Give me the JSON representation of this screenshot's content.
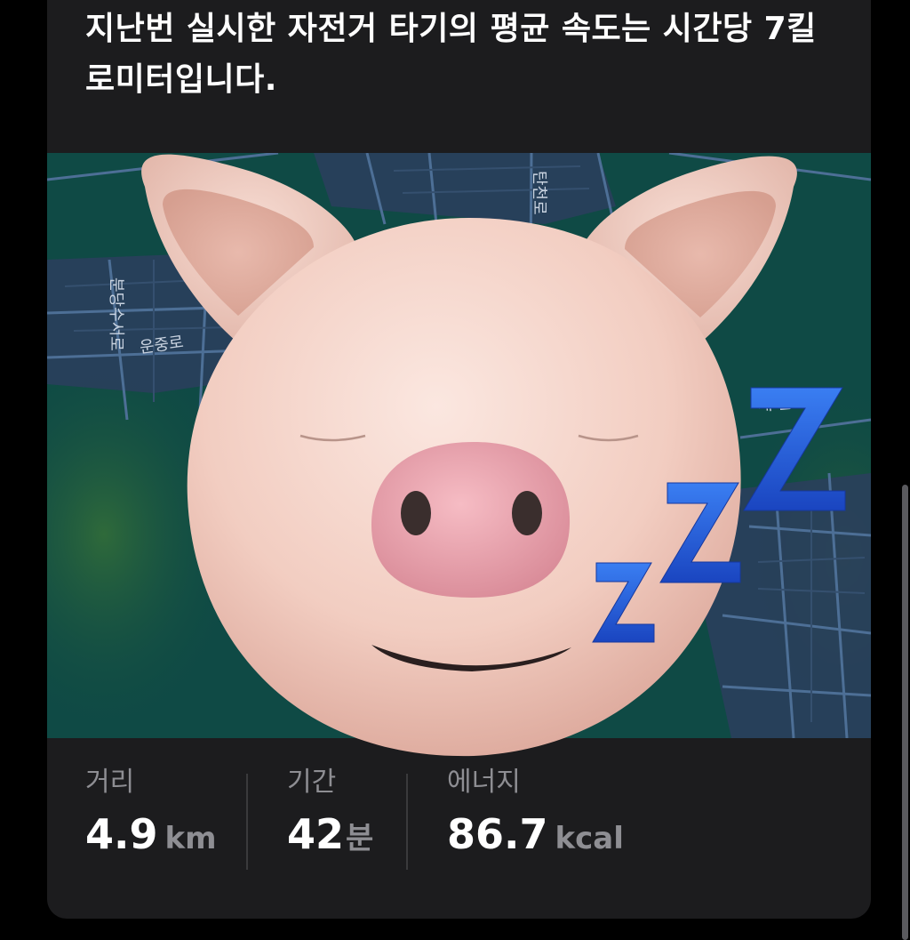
{
  "workout": {
    "headline": "지난번 실시한 자전거 타기의 평균 속도는 시간당 7킬로미터입니다."
  },
  "map": {
    "road_labels": [
      "탄천로",
      "운중로",
      "분당수서로",
      "새 둘로"
    ]
  },
  "emoji": {
    "name": "sleeping-pig-memoji",
    "zzz": [
      "z",
      "Z",
      "Z"
    ]
  },
  "stats": {
    "distance": {
      "label": "거리",
      "value": "4.9",
      "unit": "km"
    },
    "duration": {
      "label": "기간",
      "value": "42",
      "unit": "분"
    },
    "energy": {
      "label": "에너지",
      "value": "86.7",
      "unit": "kcal"
    }
  },
  "colors": {
    "card_bg": "#1c1c1e",
    "map_green": "#0f4a45",
    "map_road": "#3f5f82",
    "zzz_blue": "#1f57d6",
    "pig_skin": "#f4d2c7",
    "snout": "#eea6b0"
  }
}
